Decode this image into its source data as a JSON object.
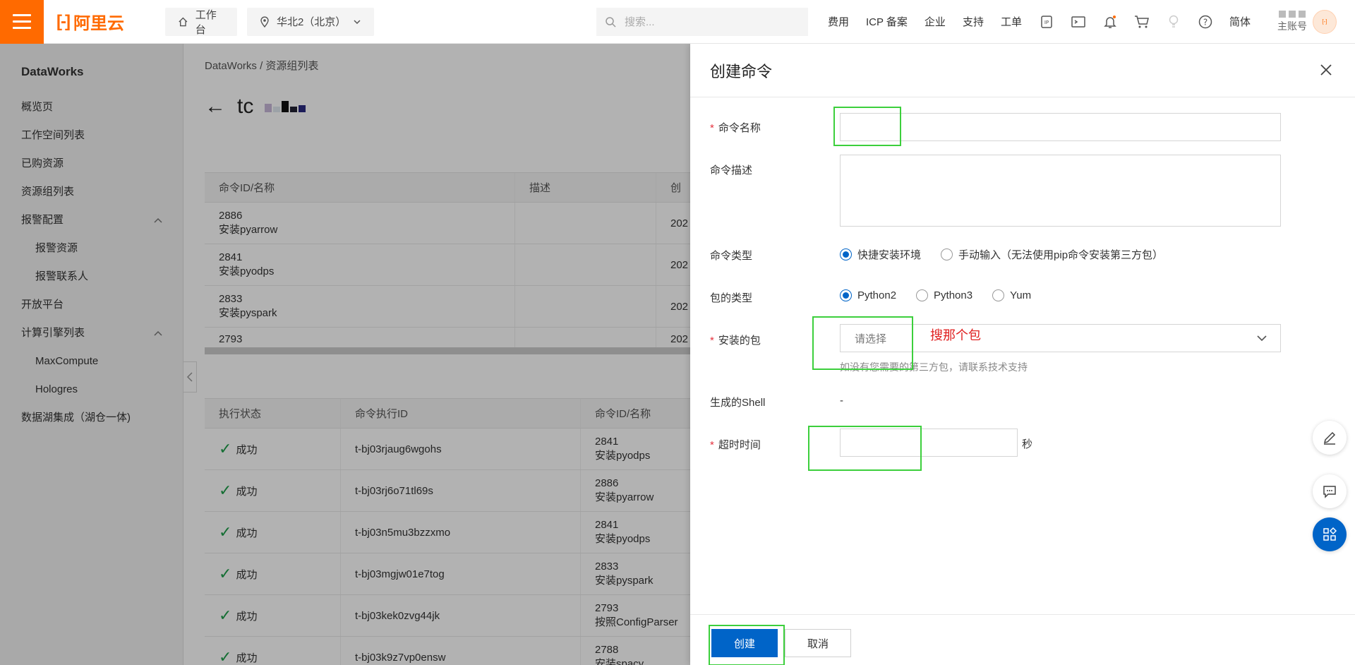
{
  "topbar": {
    "logo_text": "阿里云",
    "workbench": "工作台",
    "region": "华北2（北京）",
    "search_placeholder": "搜索...",
    "nav": [
      "费用",
      "ICP 备案",
      "企业",
      "支持",
      "工单"
    ],
    "language": "简体",
    "account": "主账号"
  },
  "sidebar": {
    "product": "DataWorks",
    "items": [
      {
        "label": "概览页",
        "sub": false
      },
      {
        "label": "工作空间列表",
        "sub": false
      },
      {
        "label": "已购资源",
        "sub": false
      },
      {
        "label": "资源组列表",
        "sub": false
      },
      {
        "label": "报警配置",
        "sub": false,
        "expandable": true
      },
      {
        "label": "报警资源",
        "sub": true
      },
      {
        "label": "报警联系人",
        "sub": true
      },
      {
        "label": "开放平台",
        "sub": false
      },
      {
        "label": "计算引擎列表",
        "sub": false,
        "expandable": true
      },
      {
        "label": "MaxCompute",
        "sub": true
      },
      {
        "label": "Hologres",
        "sub": true
      },
      {
        "label": "数据湖集成（湖仓一体)",
        "sub": false
      }
    ]
  },
  "main": {
    "breadcrumb": "DataWorks  /  资源组列表",
    "title_prefix": "tc",
    "commands_table": {
      "headers": [
        "命令ID/名称",
        "描述",
        "创"
      ],
      "rows": [
        {
          "id": "2886",
          "name": "安装pyarrow",
          "created": "202"
        },
        {
          "id": "2841",
          "name": "安装pyodps",
          "created": "202"
        },
        {
          "id": "2833",
          "name": "安装pyspark",
          "created": "202"
        },
        {
          "id": "2793",
          "name": "",
          "created": "202"
        }
      ]
    },
    "exec_table": {
      "headers": [
        "执行状态",
        "命令执行ID",
        "命令ID/名称"
      ],
      "rows": [
        {
          "status": "成功",
          "exec_id": "t-bj03rjaug6wgohs",
          "cmd_id": "2841",
          "cmd_name": "安装pyodps"
        },
        {
          "status": "成功",
          "exec_id": "t-bj03rj6o71tl69s",
          "cmd_id": "2886",
          "cmd_name": "安装pyarrow"
        },
        {
          "status": "成功",
          "exec_id": "t-bj03n5mu3bzzxmo",
          "cmd_id": "2841",
          "cmd_name": "安装pyodps"
        },
        {
          "status": "成功",
          "exec_id": "t-bj03mgjw01e7tog",
          "cmd_id": "2833",
          "cmd_name": "安装pyspark"
        },
        {
          "status": "成功",
          "exec_id": "t-bj03kek0zvg44jk",
          "cmd_id": "2793",
          "cmd_name": "按照ConfigParser"
        },
        {
          "status": "成功",
          "exec_id": "t-bj03k9z7vp0ensw",
          "cmd_id": "2788",
          "cmd_name": "安装spacy"
        }
      ]
    }
  },
  "drawer": {
    "title": "创建命令",
    "name_label": "命令名称",
    "desc_label": "命令描述",
    "type_label": "命令类型",
    "type_options": [
      "快捷安装环境",
      "手动输入（无法使用pip命令安装第三方包）"
    ],
    "type_selected": 0,
    "pkg_type_label": "包的类型",
    "pkg_type_options": [
      "Python2",
      "Python3",
      "Yum"
    ],
    "pkg_type_selected": 0,
    "pkg_label": "安装的包",
    "pkg_placeholder": "请选择",
    "pkg_hint": "如没有您需要的第三方包，请联系技术支持",
    "annotation": "搜那个包",
    "shell_label": "生成的Shell",
    "shell_value": "-",
    "timeout_label": "超时时间",
    "timeout_unit": "秒",
    "create_btn": "创建",
    "cancel_btn": "取消"
  },
  "colors": {
    "brand": "#ff6a00",
    "primary": "#0064c8",
    "success": "#1e9e4a",
    "required": "#e5323e",
    "annotation_box": "#3ccf3c",
    "annotation_text": "#e02020"
  }
}
